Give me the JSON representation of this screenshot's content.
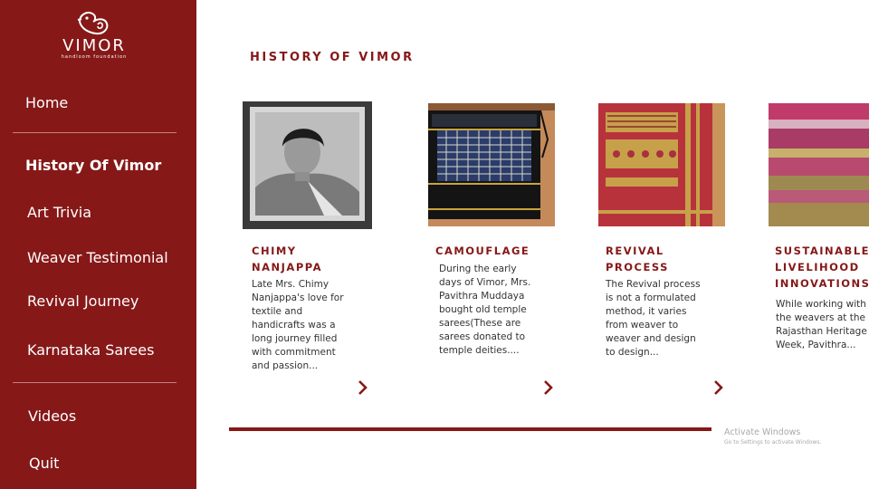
{
  "brand": {
    "name": "VIMOR",
    "tagline": "handloom foundation"
  },
  "nav": {
    "items": [
      {
        "label": "Home"
      },
      {
        "label": "History Of Vimor"
      },
      {
        "label": "Art Trivia"
      },
      {
        "label": "Weaver Testimonial"
      },
      {
        "label": "Revival Journey"
      },
      {
        "label": "Karnataka Sarees"
      },
      {
        "label": "Videos"
      },
      {
        "label": "Quit"
      }
    ],
    "active": "History Of Vimor"
  },
  "main": {
    "title": "HISTORY OF VIMOR",
    "cards": [
      {
        "title_lines": [
          "CHIMY",
          "NANJAPPA"
        ],
        "text_lines": [
          "Late Mrs. Chimy",
          "Nanjappa's love for",
          "textile and",
          "handicrafts was a",
          "long journey filled",
          "with commitment",
          "and passion..."
        ],
        "image": "vintage-portrait-photo"
      },
      {
        "title_lines": [
          "CAMOUFLAGE"
        ],
        "text_lines": [
          "During the early",
          "days of Vimor, Mrs.",
          "Pavithra Muddaya",
          "bought old temple",
          "sarees(These are",
          "sarees donated to",
          "temple deities...."
        ],
        "image": "checked-saree-photo"
      },
      {
        "title_lines": [
          "REVIVAL",
          "PROCESS"
        ],
        "text_lines": [
          "The Revival process",
          "is not a formulated",
          "method, it varies",
          "from weaver to",
          "weaver and design",
          "to design..."
        ],
        "image": "red-saree-photo"
      },
      {
        "title_lines": [
          "SUSTAINABLE",
          "LIVELIHOOD",
          "INNOVATIONS"
        ],
        "text_lines": [
          "While working with",
          "the weavers at the",
          "Rajasthan Heritage",
          "Week, Pavithra..."
        ],
        "image": "striped-fabric-photo"
      }
    ],
    "progress_fraction": 0.64
  },
  "watermark": {
    "title": "Activate Windows",
    "subtitle": "Go to Settings to activate Windows."
  },
  "colors": {
    "sidebar": "#861818",
    "accent": "#861818",
    "text": "#333333"
  }
}
